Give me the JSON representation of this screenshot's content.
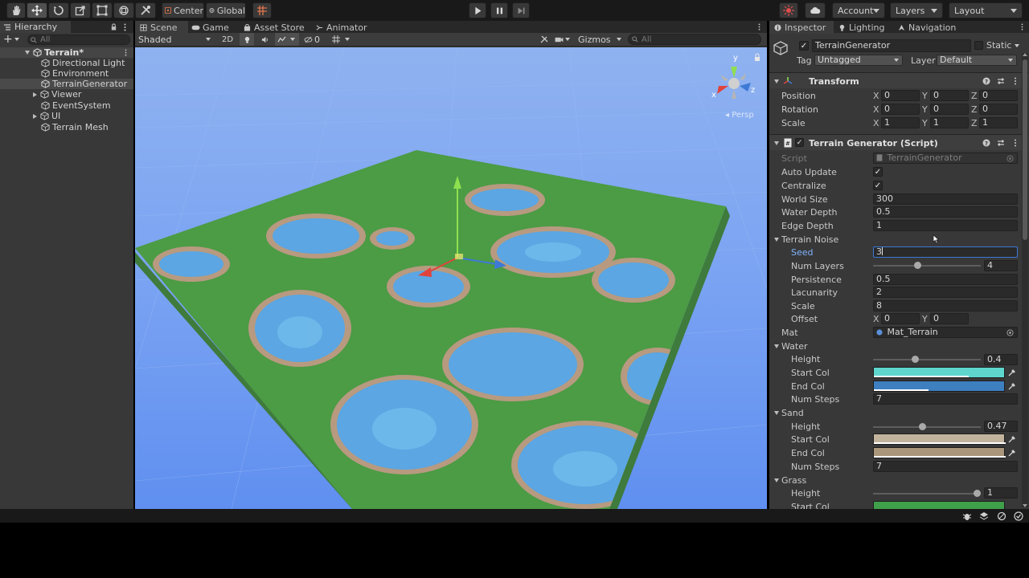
{
  "toolbar": {
    "center_label": "Center",
    "global_label": "Global",
    "account_label": "Account",
    "layers_label": "Layers",
    "layout_label": "Layout"
  },
  "hierarchy": {
    "tab_label": "Hierarchy",
    "search_placeholder": "All",
    "scene_name": "Terrain*",
    "items": [
      {
        "label": "Directional Light"
      },
      {
        "label": "Environment"
      },
      {
        "label": "TerrainGenerator"
      },
      {
        "label": "Viewer"
      },
      {
        "label": "EventSystem"
      },
      {
        "label": "UI"
      },
      {
        "label": "Terrain Mesh"
      }
    ]
  },
  "scene": {
    "tabs": [
      "Scene",
      "Game",
      "Asset Store",
      "Animator"
    ],
    "shading_mode": "Shaded",
    "mode_2d": "2D",
    "hidden_count": "0",
    "gizmos_label": "Gizmos",
    "search_placeholder": "All",
    "persp_label": "Persp",
    "axis_x": "x",
    "axis_y": "y",
    "axis_z": "z"
  },
  "inspector": {
    "tabs": [
      "Inspector",
      "Lighting",
      "Navigation"
    ],
    "object_name": "TerrainGenerator",
    "static_label": "Static",
    "tag_label": "Tag",
    "tag_value": "Untagged",
    "layer_label": "Layer",
    "layer_value": "Default",
    "transform": {
      "title": "Transform",
      "position_label": "Position",
      "rotation_label": "Rotation",
      "scale_label": "Scale",
      "position": [
        "0",
        "0",
        "0"
      ],
      "rotation": [
        "0",
        "0",
        "0"
      ],
      "scale": [
        "1",
        "1",
        "1"
      ],
      "axes": [
        "X",
        "Y",
        "Z"
      ]
    },
    "script": {
      "title": "Terrain Generator (Script)",
      "script_label": "Script",
      "script_value": "TerrainGenerator",
      "auto_update_label": "Auto Update",
      "auto_update": true,
      "centralize_label": "Centralize",
      "centralize": true,
      "world_size_label": "World Size",
      "world_size": "300",
      "water_depth_label": "Water Depth",
      "water_depth": "0.5",
      "edge_depth_label": "Edge Depth",
      "edge_depth": "1",
      "noise_label": "Terrain Noise",
      "seed_label": "Seed",
      "seed": "3",
      "num_layers_label": "Num Layers",
      "num_layers": "4",
      "num_layers_fraction": 0.43,
      "persistence_label": "Persistence",
      "persistence": "0.5",
      "lacunarity_label": "Lacunarity",
      "lacunarity": "2",
      "scale_label": "Scale",
      "scale": "8",
      "offset_label": "Offset",
      "offset_x": "0",
      "offset_y": "0",
      "mat_label": "Mat",
      "mat_value": "Mat_Terrain",
      "water": {
        "label": "Water",
        "height_label": "Height",
        "height": "0.4",
        "height_fraction": 0.4,
        "start_col_label": "Start Col",
        "start_col": "#5ed6ce",
        "end_col_label": "End Col",
        "end_col": "#3e7fc0",
        "num_steps_label": "Num Steps",
        "num_steps": "7"
      },
      "sand": {
        "label": "Sand",
        "height_label": "Height",
        "height": "0.47",
        "height_fraction": 0.47,
        "start_col_label": "Start Col",
        "start_col": "#c2b39d",
        "end_col_label": "End Col",
        "end_col": "#a9967b",
        "num_steps_label": "Num Steps",
        "num_steps": "7"
      },
      "grass": {
        "label": "Grass",
        "height_label": "Height",
        "height": "1",
        "height_fraction": 1.0,
        "start_col_label": "Start Col",
        "start_col": "#3f9f4a"
      }
    }
  },
  "colors": {
    "sky": "#6f99f0",
    "ground_grass": "#4c9b45",
    "water": "#5ba6e3",
    "sand": "#b79a80",
    "accent_blue": "#3d7ad6"
  }
}
